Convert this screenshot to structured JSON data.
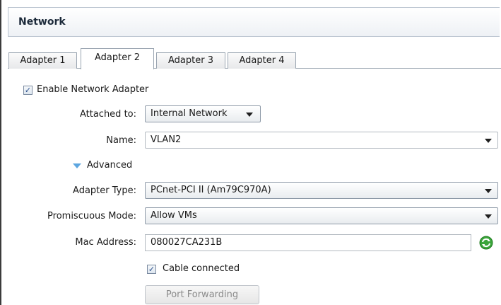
{
  "header": {
    "title": "Network"
  },
  "tabs": [
    {
      "label": "Adapter 1"
    },
    {
      "label": "Adapter 2",
      "active": true
    },
    {
      "label": "Adapter 3"
    },
    {
      "label": "Adapter 4"
    }
  ],
  "enable_adapter": {
    "label": "Enable Network Adapter",
    "checked": true
  },
  "attached_to": {
    "label": "Attached to:",
    "value": "Internal Network"
  },
  "name": {
    "label": "Name:",
    "value": "VLAN2"
  },
  "advanced": {
    "label": "Advanced",
    "expanded": true
  },
  "adapter_type": {
    "label": "Adapter Type:",
    "value": "PCnet-PCI II (Am79C970A)"
  },
  "promiscuous_mode": {
    "label": "Promiscuous Mode:",
    "value": "Allow VMs"
  },
  "mac_address": {
    "label": "Mac Address:",
    "value": "080027CA231B",
    "refresh_icon": "refresh-icon"
  },
  "cable_connected": {
    "label": "Cable connected",
    "checked": true
  },
  "port_forwarding": {
    "label": "Port Forwarding",
    "enabled": false
  },
  "colors": {
    "accent": "#5da6e0",
    "refresh_green": "#3aa53a"
  }
}
